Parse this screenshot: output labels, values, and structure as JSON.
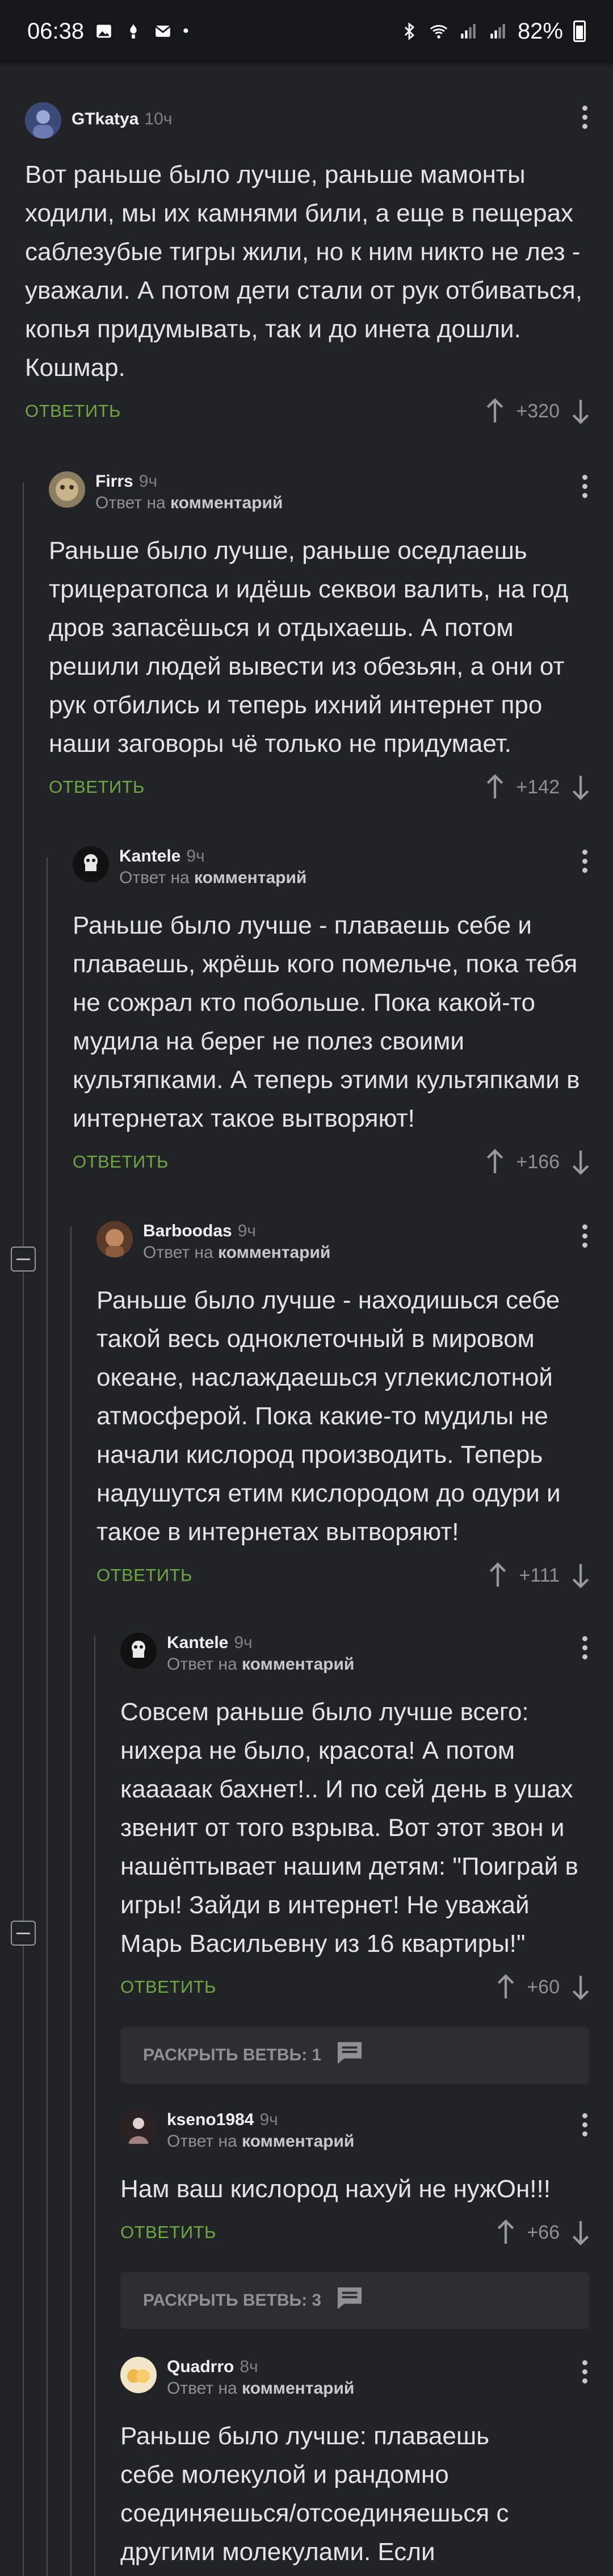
{
  "status_bar": {
    "time": "06:38",
    "battery": "82%"
  },
  "comments": [
    {
      "nick": "GTkatya",
      "ago": "10ч",
      "reply_prefix": "",
      "reply_target": "",
      "text": "Вот раньше было лучше, раньше мамонты ходили, мы их камнями били, а еще в пещерах саблезубые тигры жили, но к ним никто не лез - уважали. А потом дети стали от рук отбиваться, копья придумывать, так и до инета дошли. Кошмар.",
      "reply_label": "ОТВЕТИТЬ",
      "rating": "+320"
    },
    {
      "nick": "Firrs",
      "ago": "9ч",
      "reply_prefix": "Ответ на",
      "reply_target": "комментарий",
      "text": "Раньше было лучше, раньше оседлаешь трицератопса и идёшь секвои валить, на год дров запасёшься и отдыхаешь. А потом решили людей вывести из обезьян, а они от рук отбились и теперь ихний интернет про наши заговоры чё только не придумает.",
      "reply_label": "ОТВЕТИТЬ",
      "rating": "+142"
    },
    {
      "nick": "Kantele",
      "ago": "9ч",
      "reply_prefix": "Ответ на",
      "reply_target": "комментарий",
      "text": "Раньше было лучше  - плаваешь себе и плаваешь, жрёшь кого помельче, пока тебя не сожрал кто побольше. Пока какой-то мудила на берег не полез своими культяпками. А теперь этими культяпками в интернетах такое вытворяют!",
      "reply_label": "ОТВЕТИТЬ",
      "rating": "+166"
    },
    {
      "nick": "Barboodas",
      "ago": "9ч",
      "reply_prefix": "Ответ на",
      "reply_target": "комментарий",
      "text": "Раньше было лучше - находишься себе такой весь одноклеточный в мировом океане, наслаждаешься углекислотной атмосферой. Пока какие-то мудилы не начали кислород производить. Теперь надушутся етим кислородом до одури и такое в интернетах вытворяют!",
      "reply_label": "ОТВЕТИТЬ",
      "rating": "+111"
    },
    {
      "nick": "Kantele",
      "ago": "9ч",
      "reply_prefix": "Ответ на",
      "reply_target": "комментарий",
      "text": "Совсем раньше было лучше всего: нихера не было, красота! А потом кааааак бахнет!.. И по сей день в ушах звенит от того взрыва. Вот этот звон и нашёптывает нашим детям: \"Поиграй в игры! Зайди в интернет! Не уважай Марь Васильевну из 16 квартиры!\"",
      "reply_label": "ОТВЕТИТЬ",
      "rating": "+60",
      "expand": "РАСКРЫТЬ ВЕТВЬ: 1"
    },
    {
      "nick": "kseno1984",
      "ago": "9ч",
      "reply_prefix": "Ответ на",
      "reply_target": "комментарий",
      "text": "Нам ваш кислород нахуй не нужОн!!!",
      "reply_label": "ОТВЕТИТЬ",
      "rating": "+66",
      "expand": "РАСКРЫТЬ ВЕТВЬ: 3"
    },
    {
      "nick": "Quadrro",
      "ago": "8ч",
      "reply_prefix": "Ответ на",
      "reply_target": "комментарий",
      "text": "Раньше было лучше: плаваешь себе молекулой и рандомно соединяешься/отсоединяешься с другими молекулами. Если",
      "reply_label": "",
      "rating": ""
    }
  ]
}
